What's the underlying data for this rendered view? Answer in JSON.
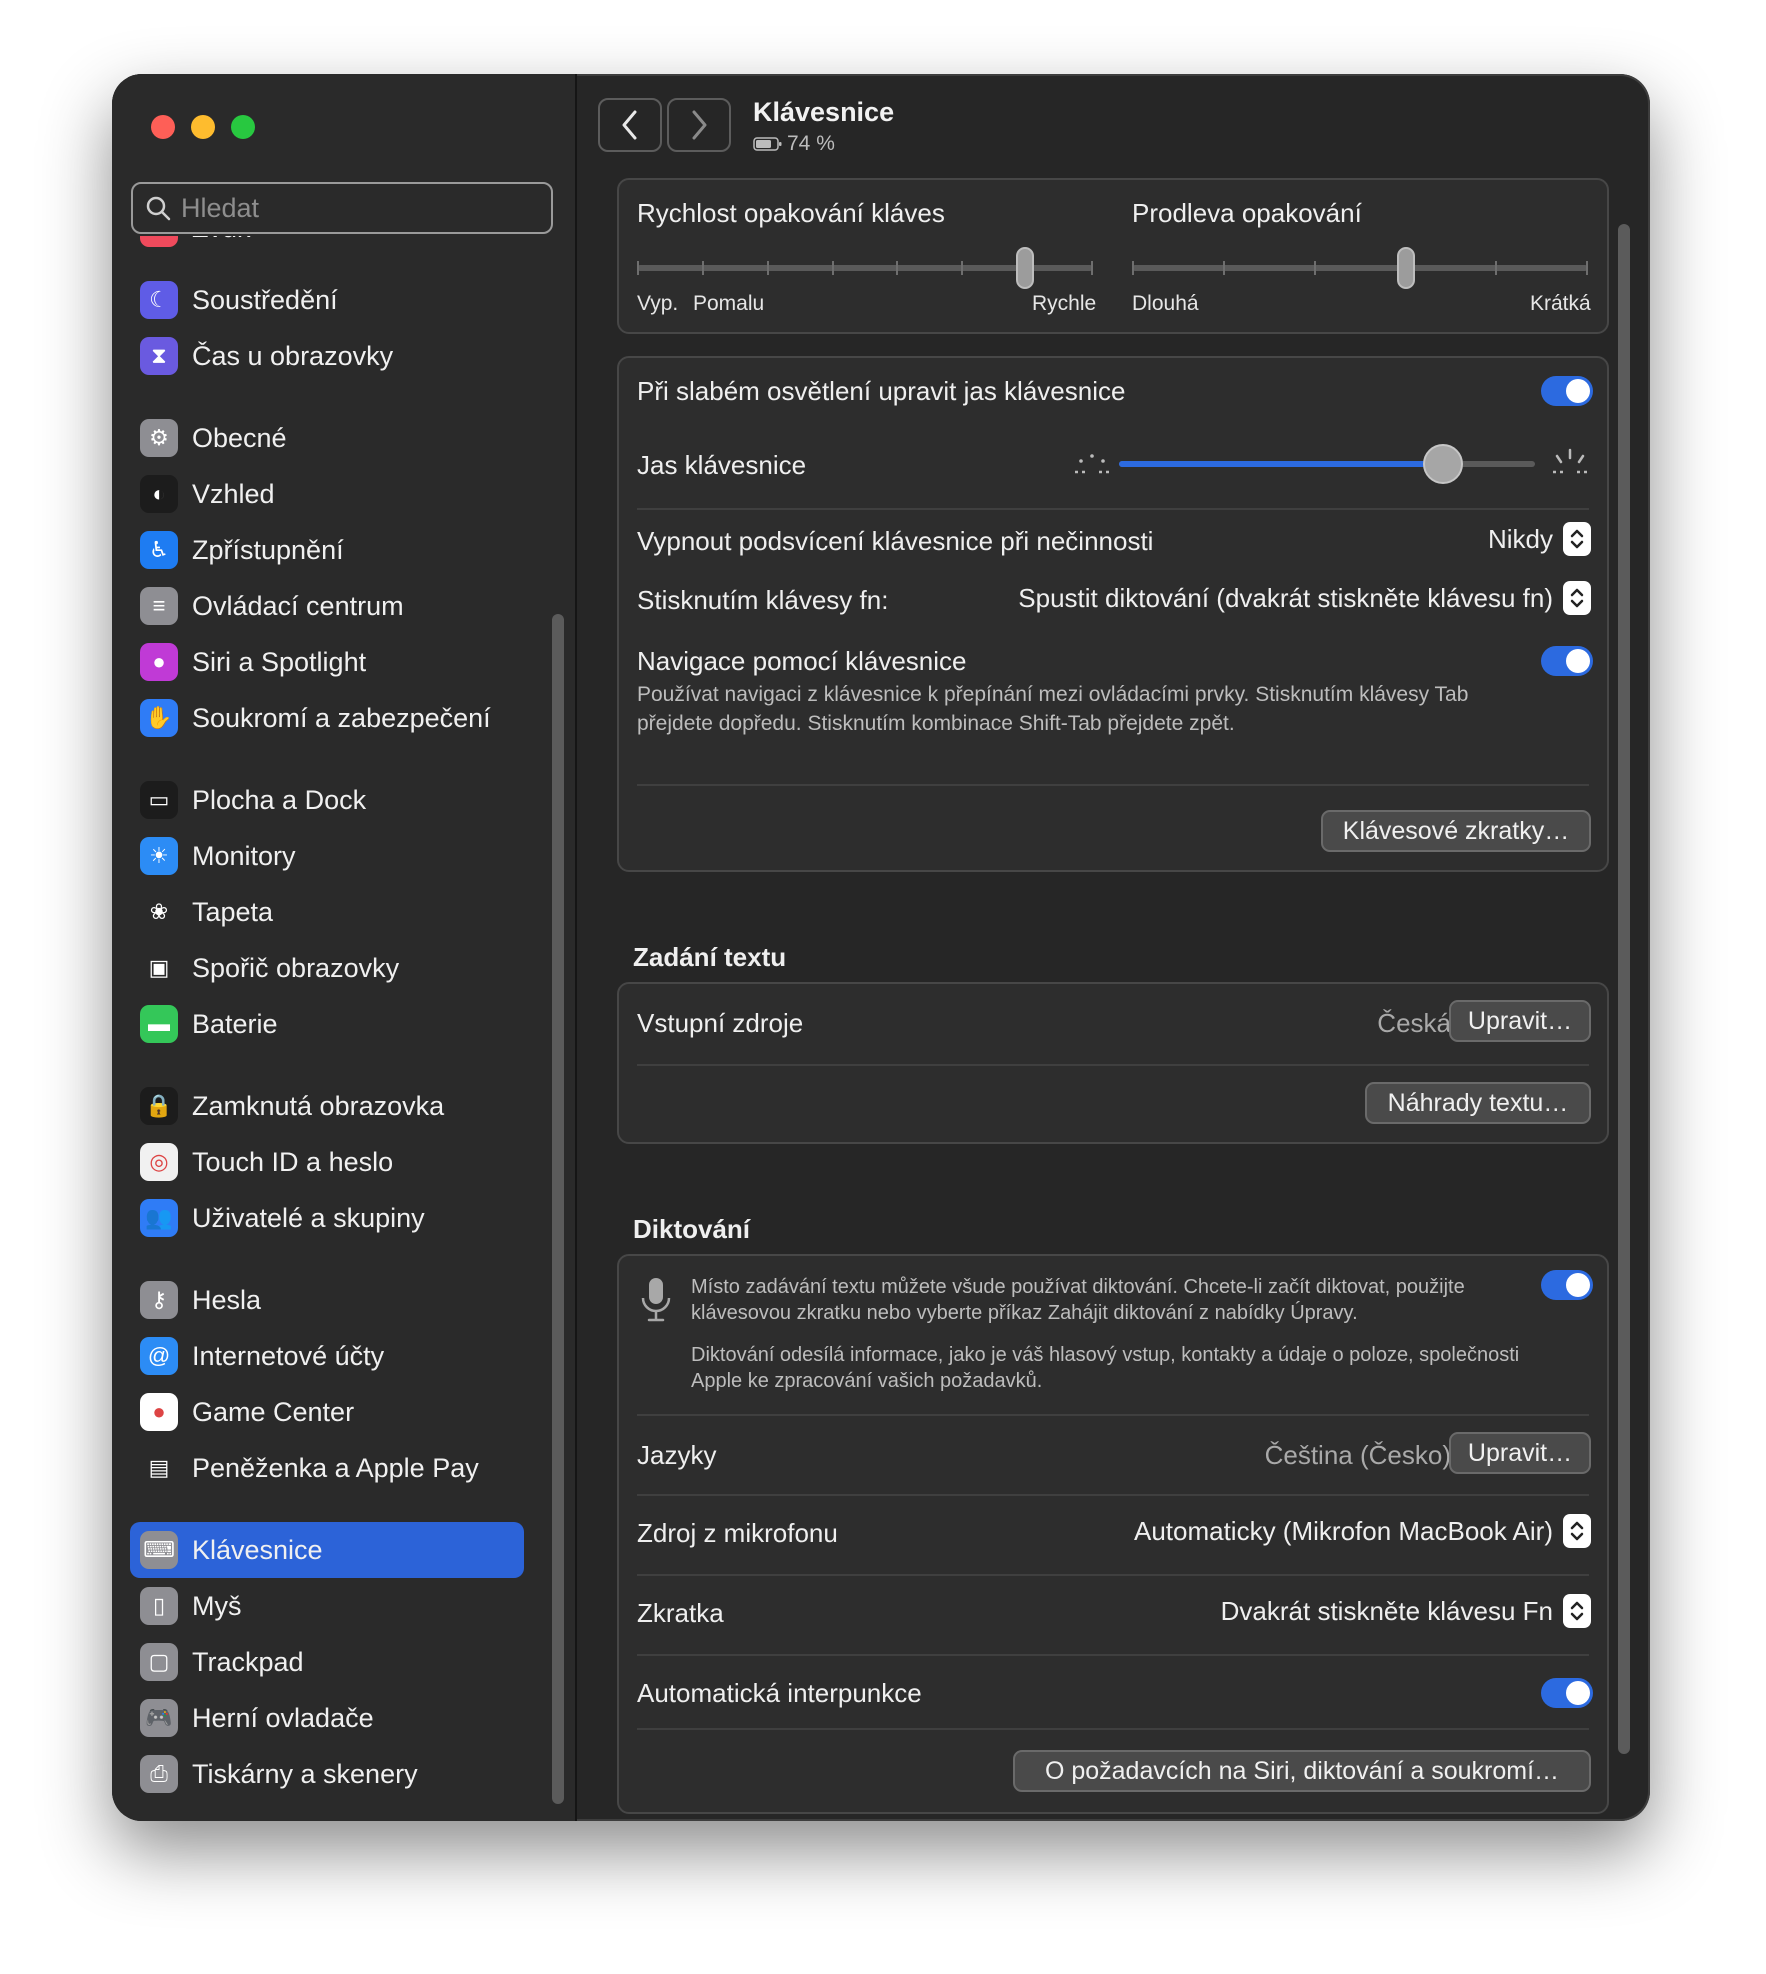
{
  "window": {
    "title": "Klávesnice",
    "battery": "74 %"
  },
  "search": {
    "placeholder": "Hledat"
  },
  "sidebar": {
    "items": [
      {
        "label": "Zvuk",
        "icon": "sound-icon",
        "color": "#ef4a5c"
      },
      {
        "label": "Soustředění",
        "icon": "moon-icon",
        "color": "#5f5ce6"
      },
      {
        "label": "Čas u obrazovky",
        "icon": "hourglass-icon",
        "color": "#6a5ae0"
      },
      {
        "label": "Obecné",
        "icon": "gear-icon",
        "color": "#8e8e93"
      },
      {
        "label": "Vzhled",
        "icon": "appearance-icon",
        "color": "#1c1c1c"
      },
      {
        "label": "Zpřístupnění",
        "icon": "accessibility-icon",
        "color": "#1e7cf2"
      },
      {
        "label": "Ovládací centrum",
        "icon": "control-center-icon",
        "color": "#8e8e93"
      },
      {
        "label": "Siri a Spotlight",
        "icon": "siri-icon",
        "color": "#c03ad6"
      },
      {
        "label": "Soukromí a zabezpečení",
        "icon": "hand-icon",
        "color": "#2f7cf6"
      },
      {
        "label": "Plocha a Dock",
        "icon": "dock-icon",
        "color": "#1c1c1c"
      },
      {
        "label": "Monitory",
        "icon": "display-icon",
        "color": "#2c8cf5"
      },
      {
        "label": "Tapeta",
        "icon": "wallpaper-icon",
        "color": "#2a2a2a"
      },
      {
        "label": "Spořič obrazovky",
        "icon": "screensaver-icon",
        "color": "#2a2a2a"
      },
      {
        "label": "Baterie",
        "icon": "battery-icon",
        "color": "#34c759"
      },
      {
        "label": "Zamknutá obrazovka",
        "icon": "lock-icon",
        "color": "#1c1c1c"
      },
      {
        "label": "Touch ID a heslo",
        "icon": "fingerprint-icon",
        "color": "#f1f1f1"
      },
      {
        "label": "Uživatelé a skupiny",
        "icon": "users-icon",
        "color": "#2f7cf6"
      },
      {
        "label": "Hesla",
        "icon": "key-icon",
        "color": "#8e8e93"
      },
      {
        "label": "Internetové účty",
        "icon": "at-icon",
        "color": "#2c8cf5"
      },
      {
        "label": "Game Center",
        "icon": "game-center-icon",
        "color": "#ffffff"
      },
      {
        "label": "Peněženka a Apple Pay",
        "icon": "wallet-icon",
        "color": "#2a2a2a"
      },
      {
        "label": "Klávesnice",
        "icon": "keyboard-icon",
        "color": "#8e8e93"
      },
      {
        "label": "Myš",
        "icon": "mouse-icon",
        "color": "#8e8e93"
      },
      {
        "label": "Trackpad",
        "icon": "trackpad-icon",
        "color": "#8e8e93"
      },
      {
        "label": "Herní ovladače",
        "icon": "gamepad-icon",
        "color": "#8e8e93"
      },
      {
        "label": "Tiskárny a skenery",
        "icon": "printer-icon",
        "color": "#8e8e93"
      }
    ],
    "active": "Klávesnice"
  },
  "repeat": {
    "rate_title": "Rychlost opakování kláves",
    "rate_off": "Vyp.",
    "rate_slow": "Pomalu",
    "rate_fast": "Rychle",
    "rate_value": 0.85,
    "delay_title": "Prodleva opakování",
    "delay_long": "Dlouhá",
    "delay_short": "Krátká",
    "delay_value": 0.6
  },
  "backlight": {
    "auto_label": "Při slabém osvětlení upravit jas klávesnice",
    "auto_on": true,
    "brightness_label": "Jas klávesnice",
    "brightness_value": 0.78,
    "idle_label": "Vypnout podsvícení klávesnice při nečinnosti",
    "idle_value": "Nikdy",
    "fn_label": "Stisknutím klávesy fn:",
    "fn_value": "Spustit diktování (dvakrát stiskněte klávesu fn)",
    "nav_label": "Navigace pomocí klávesnice",
    "nav_desc": "Používat navigaci z klávesnice k přepínání mezi ovládacími prvky. Stisknutím klávesy Tab přejdete dopředu. Stisknutím kombinace Shift-Tab přejdete zpět.",
    "nav_on": true,
    "shortcuts_button": "Klávesové zkratky…"
  },
  "text_input": {
    "section_title": "Zadání textu",
    "sources_label": "Vstupní zdroje",
    "sources_value": "Česká",
    "edit_button": "Upravit…",
    "replacements_button": "Náhrady textu…"
  },
  "dictation": {
    "section_title": "Diktování",
    "desc1": "Místo zadávání textu můžete všude používat diktování. Chcete-li začít diktovat, použijte klávesovou zkratku nebo vyberte příkaz Zahájit diktování z nabídky Úpravy.",
    "desc2": "Diktování odesílá informace, jako je váš hlasový vstup, kontakty a údaje o poloze, společnosti Apple ke zpracování vašich požadavků.",
    "on": true,
    "languages_label": "Jazyky",
    "languages_value": "Čeština (Česko)",
    "languages_button": "Upravit…",
    "mic_label": "Zdroj z mikrofonu",
    "mic_value": "Automaticky (Mikrofon MacBook Air)",
    "shortcut_label": "Zkratka",
    "shortcut_value": "Dvakrát stiskněte klávesu Fn",
    "punct_label": "Automatická interpunkce",
    "punct_on": true,
    "privacy_button": "O požadavcích na Siri, diktování a soukromí…"
  },
  "colors": {
    "accent": "#2c6ae0",
    "window_bg": "#262626"
  }
}
